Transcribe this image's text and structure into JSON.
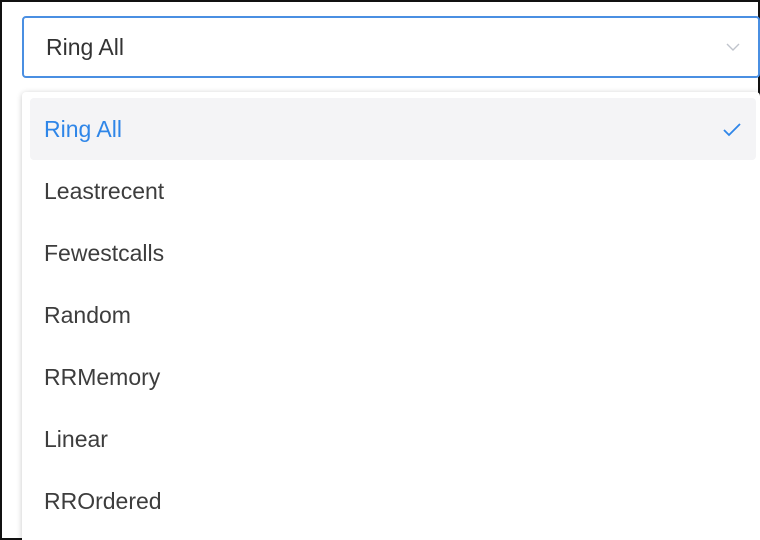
{
  "select": {
    "value": "Ring All",
    "icon": "chevron-down-icon"
  },
  "dropdown": {
    "options": [
      {
        "label": "Ring All",
        "selected": true
      },
      {
        "label": "Leastrecent",
        "selected": false
      },
      {
        "label": "Fewestcalls",
        "selected": false
      },
      {
        "label": "Random",
        "selected": false
      },
      {
        "label": "RRMemory",
        "selected": false
      },
      {
        "label": "Linear",
        "selected": false
      },
      {
        "label": "RROrdered",
        "selected": false
      }
    ],
    "selected_icon": "check-icon"
  },
  "colors": {
    "accent": "#2f86e8",
    "border_focus": "#4a8fe2",
    "selected_bg": "#f4f4f6",
    "text": "#3d3d3d"
  }
}
